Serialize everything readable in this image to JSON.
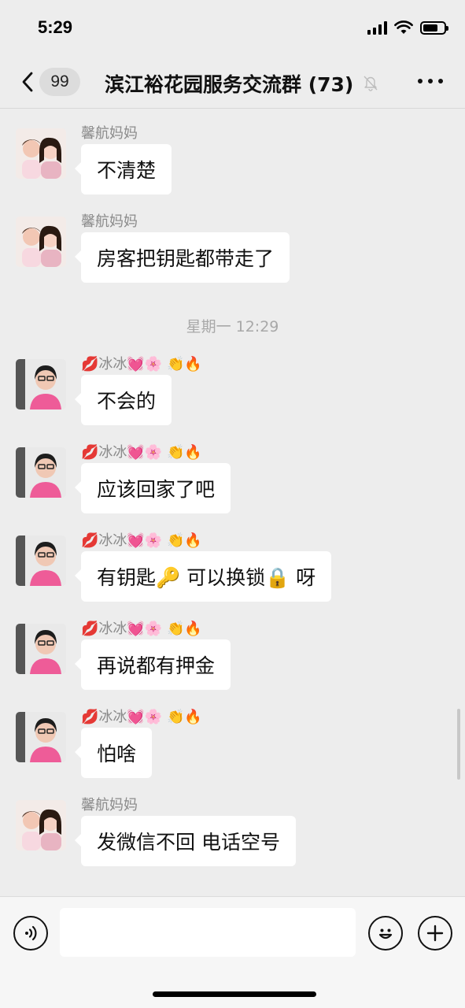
{
  "status": {
    "time": "5:29"
  },
  "nav": {
    "unread_count": "99",
    "title": "滨江裕花园服务交流群 (73)"
  },
  "messages": [
    {
      "sender": "馨航妈妈",
      "text": "不清楚"
    },
    {
      "sender": "馨航妈妈",
      "text": "房客把钥匙都带走了"
    },
    {
      "sender": "💋冰冰💓🌸 👏🔥",
      "text": "不会的"
    },
    {
      "sender": "💋冰冰💓🌸 👏🔥",
      "text": "应该回家了吧"
    },
    {
      "sender": "💋冰冰💓🌸 👏🔥",
      "text": "有钥匙🔑 可以换锁🔒 呀"
    },
    {
      "sender": "💋冰冰💓🌸 👏🔥",
      "text": "再说都有押金"
    },
    {
      "sender": "💋冰冰💓🌸 👏🔥",
      "text": "怕啥"
    },
    {
      "sender": "馨航妈妈",
      "text": "发微信不回  电话空号"
    }
  ],
  "timestamp": "星期一 12:29",
  "input": {
    "placeholder": ""
  },
  "colors": {
    "background": "#ededed",
    "bubble": "#ffffff",
    "accent_pink": "#e8528a"
  },
  "icons": [
    "back-chevron-icon",
    "mute-bell-icon",
    "more-icon",
    "voice-icon",
    "emoji-icon",
    "plus-icon"
  ]
}
